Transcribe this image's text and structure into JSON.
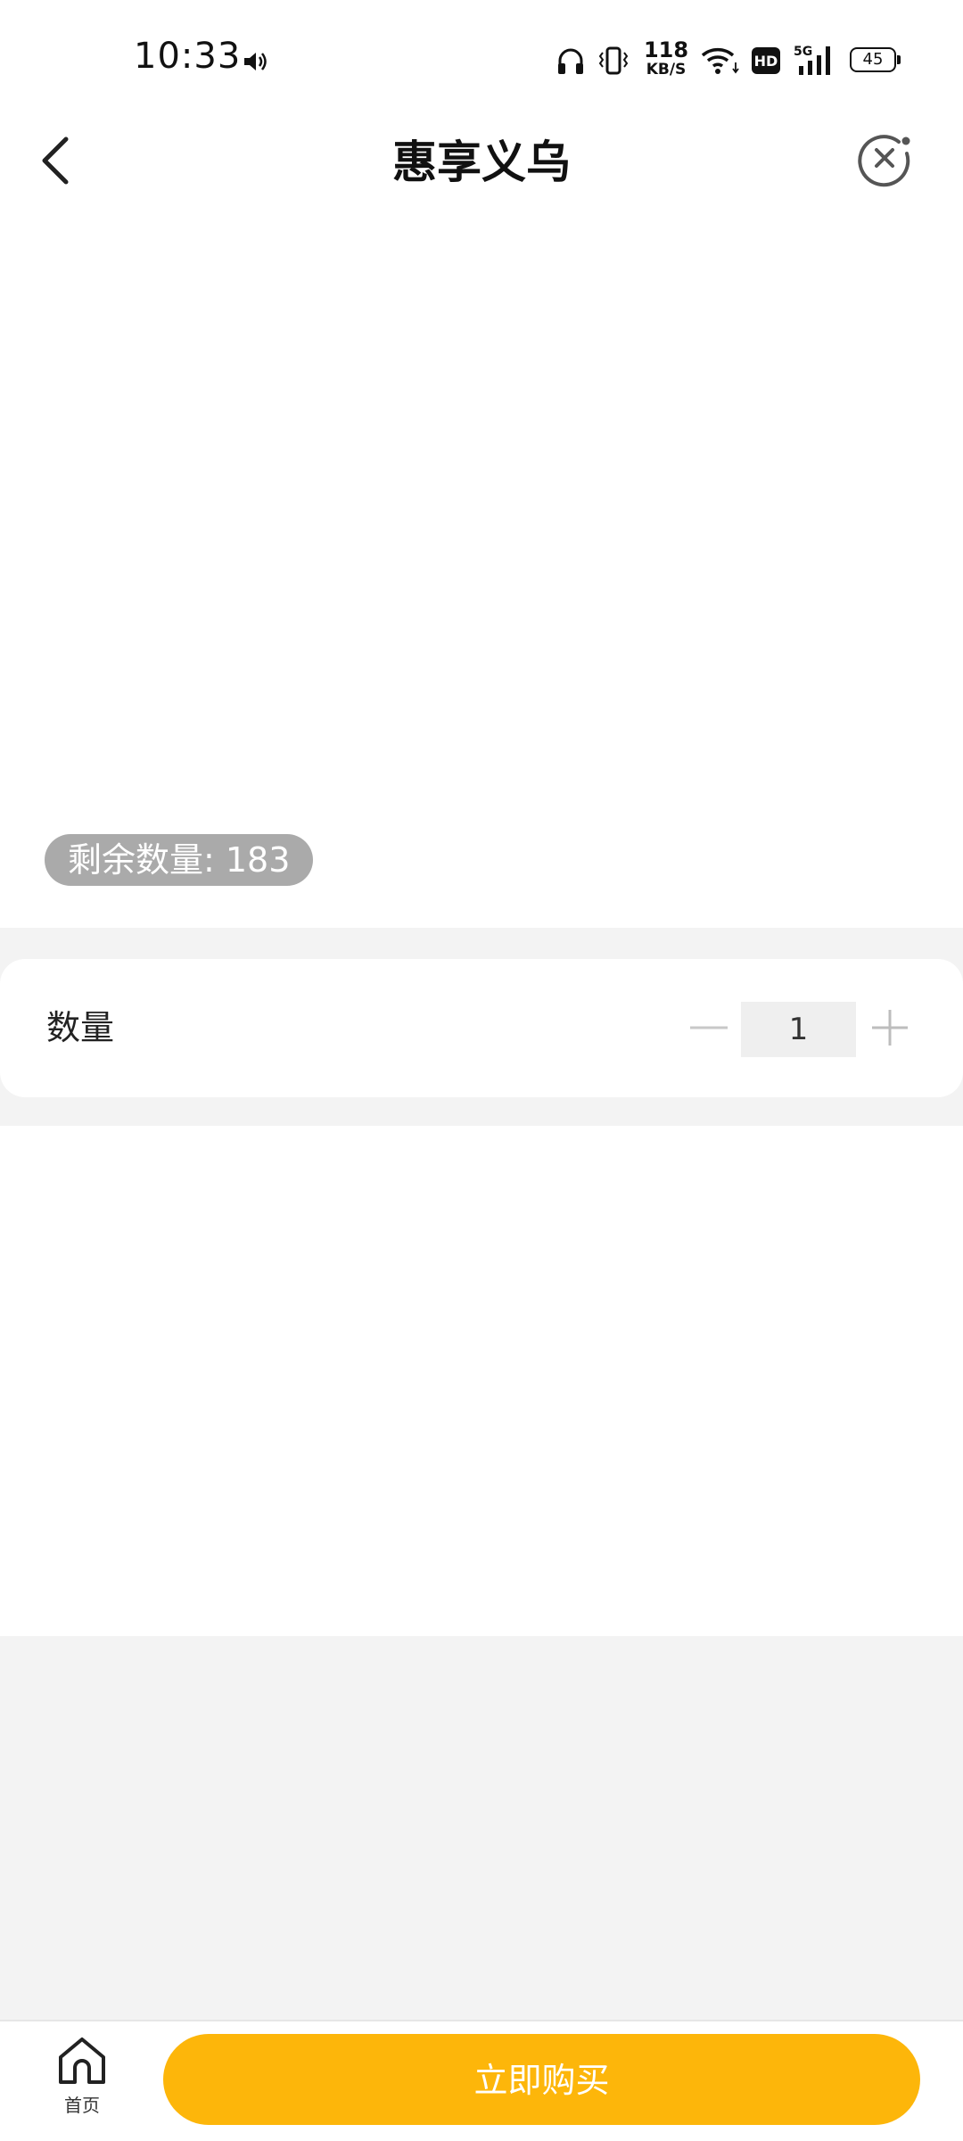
{
  "status_bar": {
    "time": "10:33",
    "net_speed_value": "118",
    "net_speed_unit": "KB/S",
    "hd_label": "HD",
    "signal_label": "5G",
    "battery": "45",
    "icons": [
      "speaker-icon",
      "headphones-icon",
      "vibrate-icon",
      "wifi-icon",
      "hd-icon",
      "signal-icon",
      "battery-icon"
    ]
  },
  "nav": {
    "title": "惠享义乌",
    "back_icon": "chevron-left-icon",
    "close_icon": "close-circle-icon"
  },
  "product": {
    "stock_label": "剩余数量: 183"
  },
  "quantity": {
    "label": "数量",
    "value": "1"
  },
  "bottom_bar": {
    "home_label": "首页",
    "buy_label": "立即购买"
  },
  "colors": {
    "accent": "#fdb60a",
    "badge": "#aaaaaa",
    "background_gray": "#f3f3f3"
  }
}
